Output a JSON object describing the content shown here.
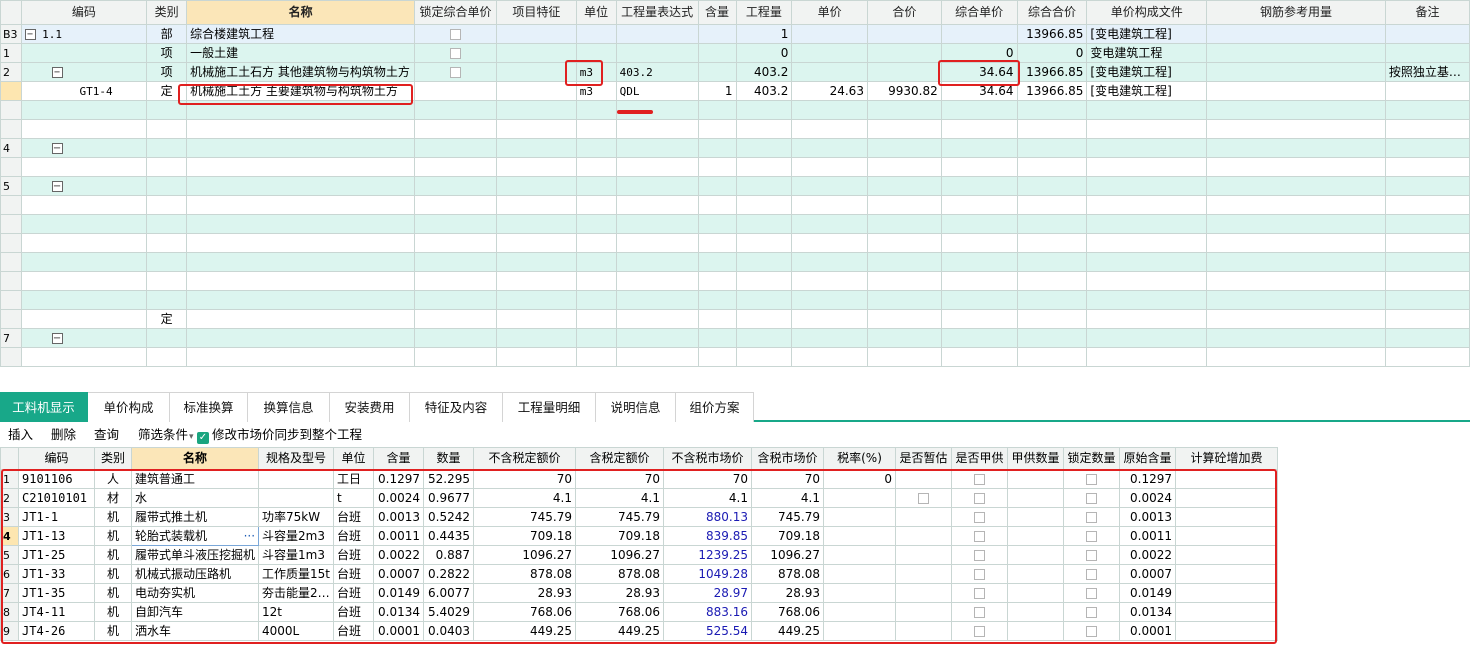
{
  "top": {
    "headers": [
      "编码",
      "类别",
      "名称",
      "锁定综合单价",
      "项目特征",
      "单位",
      "工程量表达式",
      "含量",
      "工程量",
      "单价",
      "合价",
      "综合单价",
      "综合合价",
      "单价构成文件",
      "钢筋参考用量",
      "备注"
    ],
    "rows": [
      {
        "no": "B3",
        "code": "1.1",
        "type": "部",
        "name": "综合楼建筑工程",
        "lock": true,
        "unit": "",
        "expr": "",
        "content": "",
        "qty": "1",
        "price": "",
        "total": "",
        "uprice": "",
        "utotal": "13966.85",
        "file": "[变电建筑工程]",
        "rebar": "",
        "remark": ""
      },
      {
        "no": "1",
        "code": "",
        "type": "项",
        "name": "一般土建",
        "lock": true,
        "unit": "",
        "expr": "",
        "content": "",
        "qty": "0",
        "price": "",
        "total": "",
        "uprice": "0",
        "utotal": "0",
        "file": "变电建筑工程",
        "rebar": "",
        "remark": ""
      },
      {
        "no": "2",
        "code": "",
        "type": "项",
        "name": "机械施工土石方 其他建筑物与构筑物土方",
        "lock": true,
        "unit": "m3",
        "expr": "403.2",
        "content": "",
        "qty": "403.2",
        "price": "",
        "total": "",
        "uprice": "34.64",
        "utotal": "13966.85",
        "file": "[变电建筑工程]",
        "rebar": "",
        "remark": "按照独立基…"
      },
      {
        "no": "",
        "code": "GT1-4",
        "type": "定",
        "name": "机械施工土方 主要建筑物与构筑物土方",
        "lock": false,
        "unit": "m3",
        "expr": "QDL",
        "content": "1",
        "qty": "403.2",
        "price": "24.63",
        "total": "9930.82",
        "uprice": "34.64",
        "utotal": "13966.85",
        "file": "[变电建筑工程]",
        "rebar": "",
        "remark": ""
      }
    ],
    "blurred_row_numbers": [
      "4",
      "5",
      "7"
    ],
    "blurred_type_label": "定"
  },
  "tabs": [
    "工料机显示",
    "单价构成",
    "标准换算",
    "换算信息",
    "安装费用",
    "特征及内容",
    "工程量明细",
    "说明信息",
    "组价方案"
  ],
  "toolbar": {
    "insert": "插入",
    "delete": "删除",
    "query": "查询",
    "filter": "筛选条件",
    "filter_arrow": "▾",
    "sync_label": "修改市场价同步到整个工程"
  },
  "bottom": {
    "headers": [
      "编码",
      "类别",
      "名称",
      "规格及型号",
      "单位",
      "含量",
      "数量",
      "不含税定额价",
      "含税定额价",
      "不含税市场价",
      "含税市场价",
      "税率(%)",
      "是否暂估",
      "是否甲供",
      "甲供数量",
      "锁定数量",
      "原始含量",
      "计算砼增加费"
    ],
    "rows": [
      {
        "no": "1",
        "code": "9101106",
        "type": "人",
        "name": "建筑普通工",
        "spec": "",
        "unit": "工日",
        "content": "0.1297",
        "qty": "52.295",
        "p1": "70",
        "p2": "70",
        "p3": "70",
        "p4": "70",
        "tax": "0",
        "orig": "0.1297"
      },
      {
        "no": "2",
        "code": "C21010101",
        "type": "材",
        "name": "水",
        "spec": "",
        "unit": "t",
        "content": "0.0024",
        "qty": "0.9677",
        "p1": "4.1",
        "p2": "4.1",
        "p3": "4.1",
        "p4": "4.1",
        "tax": "",
        "orig": "0.0024"
      },
      {
        "no": "3",
        "code": "JT1-1",
        "type": "机",
        "name": "履带式推土机",
        "spec": "功率75kW",
        "unit": "台班",
        "content": "0.0013",
        "qty": "0.5242",
        "p1": "745.79",
        "p2": "745.79",
        "p3": "880.13",
        "p4": "745.79",
        "tax": "",
        "orig": "0.0013"
      },
      {
        "no": "4",
        "code": "JT1-13",
        "type": "机",
        "name": "轮胎式装载机",
        "spec": "斗容量2m3",
        "unit": "台班",
        "content": "0.0011",
        "qty": "0.4435",
        "p1": "709.18",
        "p2": "709.18",
        "p3": "839.85",
        "p4": "709.18",
        "tax": "",
        "orig": "0.0011"
      },
      {
        "no": "5",
        "code": "JT1-25",
        "type": "机",
        "name": "履带式单斗液压挖掘机",
        "spec": "斗容量1m3",
        "unit": "台班",
        "content": "0.0022",
        "qty": "0.887",
        "p1": "1096.27",
        "p2": "1096.27",
        "p3": "1239.25",
        "p4": "1096.27",
        "tax": "",
        "orig": "0.0022"
      },
      {
        "no": "6",
        "code": "JT1-33",
        "type": "机",
        "name": "机械式振动压路机",
        "spec": "工作质量15t",
        "unit": "台班",
        "content": "0.0007",
        "qty": "0.2822",
        "p1": "878.08",
        "p2": "878.08",
        "p3": "1049.28",
        "p4": "878.08",
        "tax": "",
        "orig": "0.0007"
      },
      {
        "no": "7",
        "code": "JT1-35",
        "type": "机",
        "name": "电动夯实机",
        "spec": "夯击能量2…",
        "unit": "台班",
        "content": "0.0149",
        "qty": "6.0077",
        "p1": "28.93",
        "p2": "28.93",
        "p3": "28.97",
        "p4": "28.93",
        "tax": "",
        "orig": "0.0149"
      },
      {
        "no": "8",
        "code": "JT4-11",
        "type": "机",
        "name": "自卸汽车",
        "spec": "12t",
        "unit": "台班",
        "content": "0.0134",
        "qty": "5.4029",
        "p1": "768.06",
        "p2": "768.06",
        "p3": "883.16",
        "p4": "768.06",
        "tax": "",
        "orig": "0.0134"
      },
      {
        "no": "9",
        "code": "JT4-26",
        "type": "机",
        "name": "洒水车",
        "spec": "4000L",
        "unit": "台班",
        "content": "0.0001",
        "qty": "0.0403",
        "p1": "449.25",
        "p2": "449.25",
        "p3": "525.54",
        "p4": "449.25",
        "tax": "",
        "orig": "0.0001"
      }
    ],
    "more_glyph": "···"
  },
  "colors": {
    "accent": "#18a889",
    "highlight_red": "#e02020",
    "row_green": "#dcf5ef",
    "market_price_blue": "#1a1ab3"
  }
}
